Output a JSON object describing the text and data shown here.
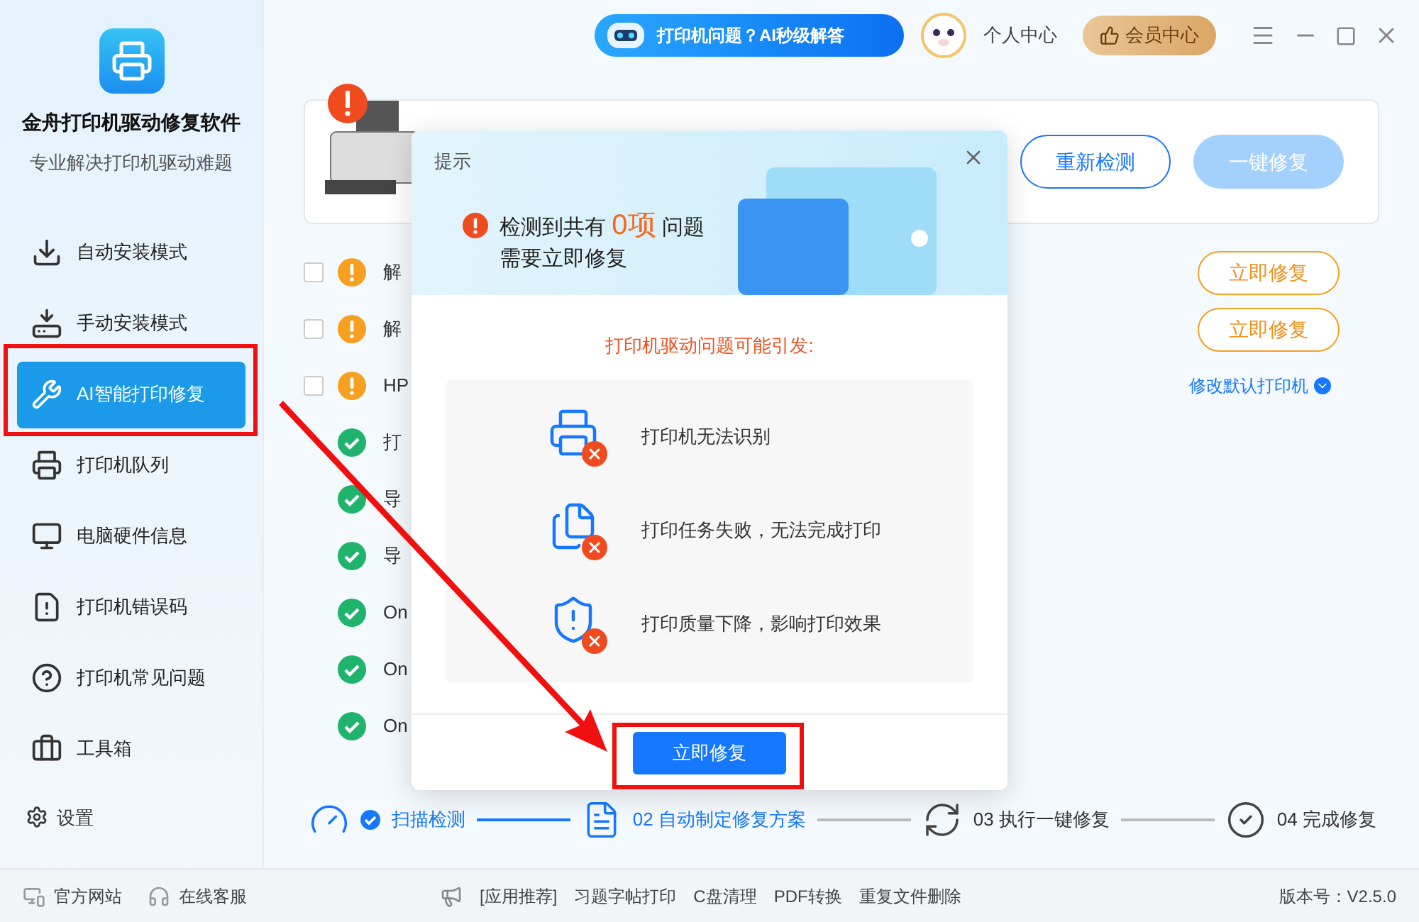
{
  "app": {
    "title": "金舟打印机驱动修复软件",
    "subtitle": "专业解决打印机驱动难题"
  },
  "sidebar": {
    "items": [
      {
        "label": "自动安装模式",
        "selected": false
      },
      {
        "label": "手动安装模式",
        "selected": false
      },
      {
        "label": "AI智能打印修复",
        "selected": true
      },
      {
        "label": "打印机队列",
        "selected": false
      },
      {
        "label": "电脑硬件信息",
        "selected": false
      },
      {
        "label": "打印机错误码",
        "selected": false
      },
      {
        "label": "打印机常见问题",
        "selected": false
      },
      {
        "label": "工具箱",
        "selected": false
      }
    ],
    "settings": "设置"
  },
  "topbar": {
    "ai_banner": "打印机问题？AI秒级解答",
    "profile": "个人中心",
    "vip": "会员中心"
  },
  "summary": {
    "rescan": "重新检测",
    "fix_all": {
      "label": "一键修复",
      "disabled": true
    }
  },
  "issues": [
    {
      "kind": "warning",
      "checked": false,
      "text": "解",
      "action": "立即修复"
    },
    {
      "kind": "warning",
      "checked": false,
      "text": "解",
      "action": "立即修复"
    },
    {
      "kind": "warning",
      "checked": false,
      "text": "HP",
      "link": "修改默认打印机"
    },
    {
      "kind": "ok",
      "text": "打"
    },
    {
      "kind": "ok",
      "text": "导"
    },
    {
      "kind": "ok",
      "text": "导"
    },
    {
      "kind": "ok",
      "text": "On"
    },
    {
      "kind": "ok",
      "text": "On"
    },
    {
      "kind": "ok",
      "text": "On"
    }
  ],
  "steps": [
    {
      "label": "扫描检测",
      "done": true,
      "active": true
    },
    {
      "label": "02 自动制定修复方案",
      "done": false,
      "active": true
    },
    {
      "label": "03 执行一键修复",
      "done": false,
      "active": false
    },
    {
      "label": "04 完成修复",
      "done": false,
      "active": false
    }
  ],
  "dialog": {
    "title": "提示",
    "message_prefix": "检测到共有",
    "count": "0项",
    "message_suffix": "问题",
    "message_line2": "需要立即修复",
    "subtitle": "打印机驱动问题可能引发:",
    "effects": [
      "打印机无法识别",
      "打印任务失败，无法完成打印",
      "打印质量下降，影响打印效果"
    ],
    "button": "立即修复"
  },
  "footer": {
    "links": [
      "官方网站",
      "在线客服"
    ],
    "promo_label": "[应用推荐]",
    "promos": [
      "习题字帖打印",
      "C盘清理",
      "PDF转换",
      "重复文件删除"
    ],
    "version": "版本号：V2.5.0"
  }
}
